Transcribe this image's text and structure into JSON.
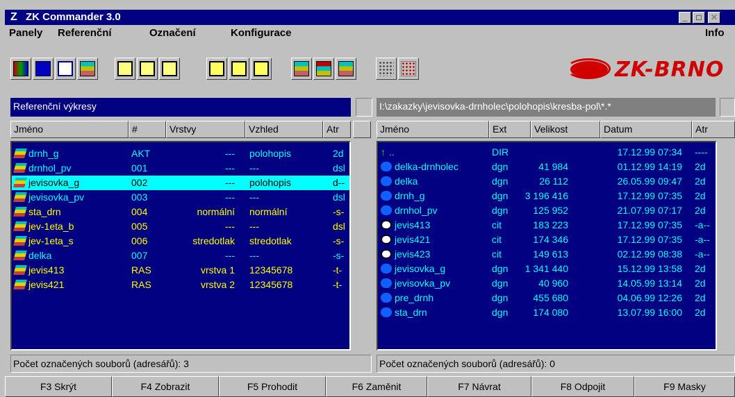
{
  "window": {
    "title": "ZK Commander 3.0"
  },
  "menu": {
    "items": [
      "Panely",
      "Referenční",
      "Označení",
      "Konfigurace"
    ],
    "info": "Info"
  },
  "toolbar": {
    "icons": [
      "map-icon",
      "zk-logo-icon",
      "windows-icon",
      "layers-icon",
      "add-file-icon",
      "remove-file-icon",
      "close-file-icon",
      "folder-up-icon",
      "folder-icon",
      "folder-all-icon",
      "layers-right-icon",
      "layers-left-icon",
      "fraction-icon",
      "grid-select-icon",
      "grid-deselect-icon"
    ]
  },
  "logo": {
    "text": "ZK-BRNO",
    "small": "ZK-BRNO"
  },
  "left_panel": {
    "title": "Referenční výkresy",
    "columns": [
      "Jméno",
      "#",
      "Vrstvy",
      "Vzhled",
      "Atr"
    ],
    "rows": [
      {
        "name": "drnh_g",
        "num": "AKT",
        "layers": "---",
        "look": "polohopis",
        "atr": "2d"
      },
      {
        "name": "drnhol_pv",
        "num": "001",
        "layers": "---",
        "look": "---",
        "atr": "dsl"
      },
      {
        "name": "jevisovka_g",
        "num": "002",
        "layers": "---",
        "look": "polohopis",
        "atr": "d--"
      },
      {
        "name": "jevisovka_pv",
        "num": "003",
        "layers": "---",
        "look": "---",
        "atr": "dsl"
      },
      {
        "name": "sta_drn",
        "num": "004",
        "layers": "normální",
        "look": "normální",
        "atr": "-s-"
      },
      {
        "name": "jev-1eta_b",
        "num": "005",
        "layers": "---",
        "look": "---",
        "atr": "dsl"
      },
      {
        "name": "jev-1eta_s",
        "num": "006",
        "layers": "stredotlak",
        "look": "stredotlak",
        "atr": "-s-"
      },
      {
        "name": "delka",
        "num": "007",
        "layers": "---",
        "look": "---",
        "atr": "-s-"
      },
      {
        "name": "jevis413",
        "num": "RAS",
        "layers": "vrstva 1",
        "look": "12345678",
        "atr": "-t-"
      },
      {
        "name": "jevis421",
        "num": "RAS",
        "layers": "vrstva 2",
        "look": "12345678",
        "atr": "-t-"
      }
    ],
    "status": "Počet označených souborů (adresářů): 3"
  },
  "right_panel": {
    "path": "I:\\zakazky\\jevisovka-drnholec\\polohopis\\kresba-pol\\*.*",
    "columns": [
      "Jméno",
      "Ext",
      "Velikost",
      "Datum",
      "Atr"
    ],
    "rows": [
      {
        "name": "..",
        "ext": "DIR",
        "size": "",
        "date": "17.12.99 07:34",
        "atr": "----"
      },
      {
        "name": "delka-drnholec",
        "ext": "dgn",
        "size": "41 984",
        "date": "01.12.99 14:19",
        "atr": "2d"
      },
      {
        "name": "delka",
        "ext": "dgn",
        "size": "26 112",
        "date": "26.05.99 09:47",
        "atr": "2d"
      },
      {
        "name": "drnh_g",
        "ext": "dgn",
        "size": "3 196 416",
        "date": "17.12.99 07:35",
        "atr": "2d"
      },
      {
        "name": "drnhol_pv",
        "ext": "dgn",
        "size": "125 952",
        "date": "21.07.99 07:17",
        "atr": "2d"
      },
      {
        "name": "jevis413",
        "ext": "cit",
        "size": "183 223",
        "date": "17.12.99 07:35",
        "atr": "-a--"
      },
      {
        "name": "jevis421",
        "ext": "cit",
        "size": "174 346",
        "date": "17.12.99 07:35",
        "atr": "-a--"
      },
      {
        "name": "jevis423",
        "ext": "cit",
        "size": "149 613",
        "date": "02.12.99 08:38",
        "atr": "-a--"
      },
      {
        "name": "jevisovka_g",
        "ext": "dgn",
        "size": "1 341 440",
        "date": "15.12.99 13:58",
        "atr": "2d"
      },
      {
        "name": "jevisovka_pv",
        "ext": "dgn",
        "size": "40 960",
        "date": "14.05.99 13:14",
        "atr": "2d"
      },
      {
        "name": "pre_drnh",
        "ext": "dgn",
        "size": "455 680",
        "date": "04.06.99 12:26",
        "atr": "2d"
      },
      {
        "name": "sta_drn",
        "ext": "dgn",
        "size": "174 080",
        "date": "13.07.99 16:00",
        "atr": "2d"
      }
    ],
    "status": "Počet označených souborů (adresářů): 0"
  },
  "fkeys": [
    "F3 Skrýt",
    "F4 Zobrazit",
    "F5 Prohodit",
    "F6 Zaměnit",
    "F7 Návrat",
    "F8 Odpojit",
    "F9 Masky"
  ],
  "colors": {
    "panel_bg": "#000080",
    "selected_bg": "#00ffff",
    "logo_red": "#d00000",
    "text_cyan": "#00ffff",
    "text_yellow": "#ffff00"
  }
}
